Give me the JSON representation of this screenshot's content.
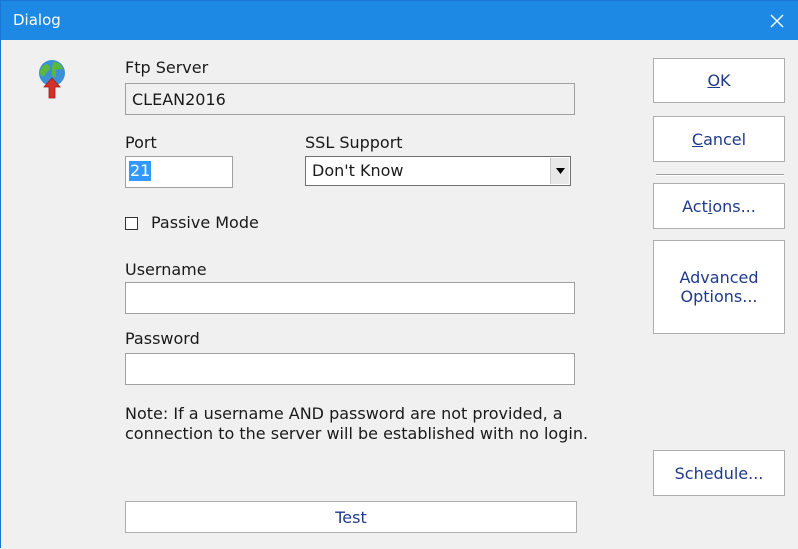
{
  "window": {
    "title": "Dialog",
    "close_glyph": "✕"
  },
  "form": {
    "ftp_server_label": "Ftp Server",
    "ftp_server_value": "CLEAN2016",
    "port_label": "Port",
    "port_value": "21",
    "ssl_label": "SSL Support",
    "ssl_value": "Don't Know",
    "passive_label": "Passive Mode",
    "passive_checked": false,
    "username_label": "Username",
    "username_value": "",
    "password_label": "Password",
    "password_value": "",
    "note": "Note: If a username AND password are not provided, a connection to the server will be established with no login."
  },
  "buttons": {
    "ok": {
      "accel": "O",
      "rest": "K"
    },
    "cancel": {
      "accel": "C",
      "rest": "ancel"
    },
    "actions": {
      "pre": "Act",
      "accel": "i",
      "rest": "ons..."
    },
    "advanced_line1": "Advanced",
    "advanced_line2": "Options...",
    "schedule": "Schedule...",
    "test": "Test"
  },
  "icons": {
    "app_icon": "globe-upload-icon",
    "close": "close-icon",
    "dropdown": "chevron-down-icon"
  },
  "colors": {
    "titlebar": "#1e88e5",
    "dialog_bg": "#f0f0f0",
    "button_text": "#1f3a8a",
    "selection": "#3399ff"
  }
}
